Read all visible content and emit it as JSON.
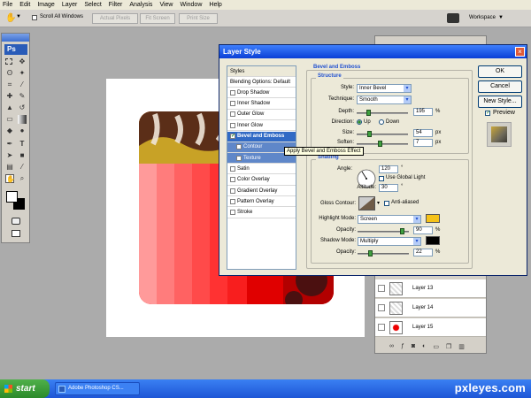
{
  "menubar": {
    "items": [
      "File",
      "Edit",
      "Image",
      "Layer",
      "Select",
      "Filter",
      "Analysis",
      "View",
      "Window",
      "Help"
    ]
  },
  "options": {
    "scroll_all": "Scroll All Windows",
    "actual_pixels": "Actual Pixels",
    "fit_screen": "Fit Screen",
    "print_size": "Print Size",
    "workspace": "Workspace"
  },
  "tools": {
    "logo": "Ps"
  },
  "layers": {
    "rows": [
      "Layer 13",
      "Layer 14",
      "Layer 15"
    ]
  },
  "dialog": {
    "title": "Layer Style",
    "styles_header": "Styles",
    "styles": [
      {
        "label": "Blending Options: Default",
        "check": false,
        "selected": false,
        "sub": false
      },
      {
        "label": "Drop Shadow",
        "check": true,
        "selected": false,
        "sub": false
      },
      {
        "label": "Inner Shadow",
        "check": true,
        "selected": false,
        "sub": false
      },
      {
        "label": "Outer Glow",
        "check": true,
        "selected": false,
        "sub": false
      },
      {
        "label": "Inner Glow",
        "check": true,
        "selected": false,
        "sub": false
      },
      {
        "label": "Bevel and Emboss",
        "check": true,
        "selected": true,
        "sub": false
      },
      {
        "label": "Contour",
        "check": true,
        "selected": false,
        "sub": true
      },
      {
        "label": "Texture",
        "check": true,
        "selected": false,
        "sub": true
      },
      {
        "label": "Satin",
        "check": true,
        "selected": false,
        "sub": false
      },
      {
        "label": "Color Overlay",
        "check": true,
        "selected": false,
        "sub": false
      },
      {
        "label": "Gradient Overlay",
        "check": true,
        "selected": false,
        "sub": false
      },
      {
        "label": "Pattern Overlay",
        "check": true,
        "selected": false,
        "sub": false
      },
      {
        "label": "Stroke",
        "check": true,
        "selected": false,
        "sub": false
      }
    ],
    "tooltip": "Apply Bevel and Emboss Effect",
    "bevel_title": "Bevel and Emboss",
    "structure": {
      "title": "Structure",
      "style_label": "Style:",
      "style_value": "Inner Bevel",
      "technique_label": "Technique:",
      "technique_value": "Smooth",
      "depth_label": "Depth:",
      "depth_value": "195",
      "depth_unit": "%",
      "depth_level": 0.2,
      "direction_label": "Direction:",
      "up": "Up",
      "down": "Down",
      "size_label": "Size:",
      "size_value": "54",
      "size_unit": "px",
      "size_level": 0.22,
      "soften_label": "Soften:",
      "soften_value": "7",
      "soften_unit": "px",
      "soften_level": 0.45
    },
    "shading": {
      "title": "Shading",
      "angle_label": "Angle:",
      "angle_value": "120",
      "angle_unit": "°",
      "global_light": "Use Global Light",
      "altitude_label": "Altitude:",
      "altitude_value": "30",
      "altitude_unit": "°",
      "gloss_label": "Gloss Contour:",
      "anti_aliased": "Anti-aliased",
      "highlight_label": "Highlight Mode:",
      "highlight_value": "Screen",
      "highlight_color": "#f5c218",
      "h_opacity_label": "Opacity:",
      "h_opacity_value": "90",
      "h_opacity_unit": "%",
      "h_opacity_level": 0.9,
      "shadow_label": "Shadow Mode:",
      "shadow_value": "Multiply",
      "shadow_color": "#000000",
      "s_opacity_label": "Opacity:",
      "s_opacity_value": "22",
      "s_opacity_unit": "%",
      "s_opacity_level": 0.22
    },
    "buttons": {
      "ok": "OK",
      "cancel": "Cancel",
      "new_style": "New Style...",
      "preview": "Preview"
    }
  },
  "taskbar": {
    "start": "start",
    "app": "Adobe Photoshop CS...",
    "watermark": "pxleyes.com"
  }
}
